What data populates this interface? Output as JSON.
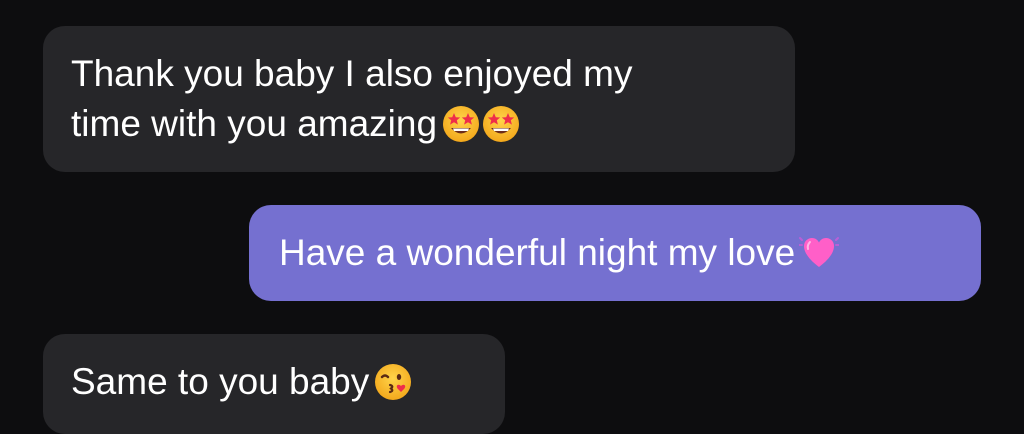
{
  "conversation": {
    "messages": [
      {
        "direction": "incoming",
        "line1": "Thank you baby I also enjoyed my",
        "line2": "time with you amazing",
        "emojis": [
          "star-struck-emoji",
          "star-struck-emoji"
        ]
      },
      {
        "direction": "outgoing",
        "text": "Have a wonderful night my love",
        "emojis": [
          "beating-heart-emoji"
        ]
      },
      {
        "direction": "incoming",
        "text": "Same to you baby",
        "emojis": [
          "kissing-face-emoji"
        ]
      }
    ]
  },
  "colors": {
    "background": "#0d0d0f",
    "incoming_bubble": "#262629",
    "outgoing_bubble": "#7570d0",
    "text": "#ffffff"
  }
}
